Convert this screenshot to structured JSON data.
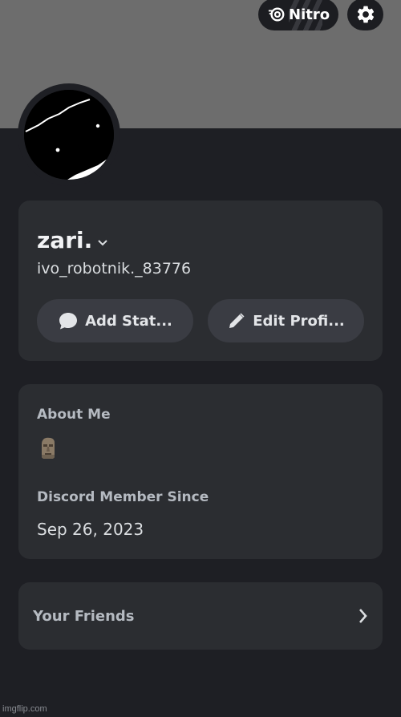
{
  "header": {
    "nitro_label": "Nitro",
    "icons": {
      "nitro": "nitro-wheel-icon",
      "settings": "gear-icon"
    }
  },
  "profile": {
    "display_name": "zari.",
    "username": "ivo_robotnik._83776",
    "add_status_label": "Add Stat...",
    "edit_profile_label": "Edit Profi...",
    "icons": {
      "display_name_dropdown": "chevron-down-icon",
      "add_status": "speech-bubble-icon",
      "edit_profile": "pencil-icon"
    }
  },
  "about": {
    "title": "About Me",
    "bio_emoji": "moai-emoji",
    "member_since_label": "Discord Member Since",
    "member_since_date": "Sep 26, 2023"
  },
  "friends": {
    "label": "Your Friends",
    "icon": "chevron-right-icon"
  },
  "watermark": "imgflip.com",
  "colors": {
    "banner": "#6d6d6d",
    "background": "#1e1f24",
    "card": "#2b2d31",
    "pill": "#3a3c43"
  }
}
